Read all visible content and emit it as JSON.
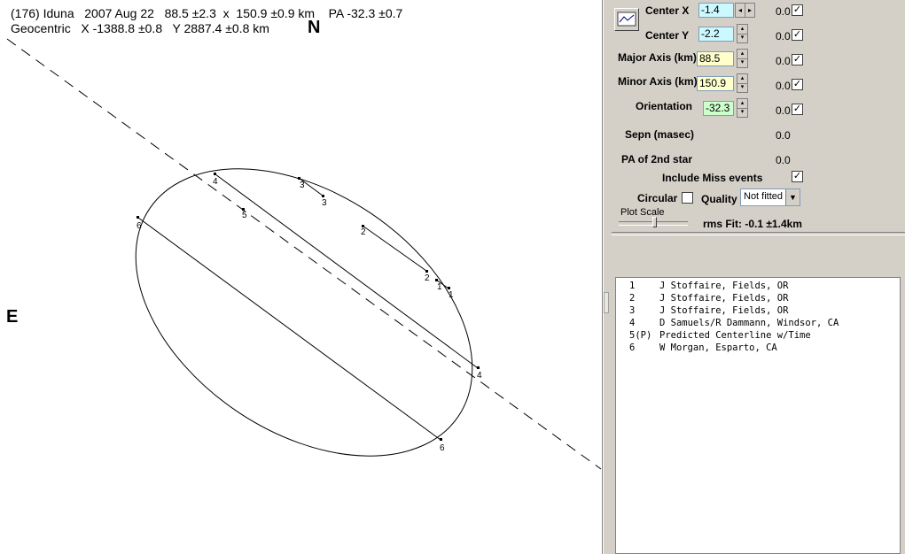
{
  "header": {
    "line1": "(176) Iduna   2007 Aug 22   88.5 ±2.3  x  150.9 ±0.9 km    PA -32.3 ±0.7",
    "line2": "Geocentric   X -1388.8 ±0.8   Y 2887.4 ±0.8 km"
  },
  "compass": {
    "north": "N",
    "east": "E"
  },
  "chord_labels": [
    "1",
    "1",
    "2",
    "2",
    "3",
    "3",
    "4",
    "4",
    "5",
    "6",
    "6"
  ],
  "panel": {
    "center_x": {
      "label": "Center X",
      "value": "-1.4",
      "sigma": "0.0",
      "checked": "✓"
    },
    "center_y": {
      "label": "Center Y",
      "value": "-2.2",
      "sigma": "0.0",
      "checked": "✓"
    },
    "major_axis": {
      "label": "Major Axis (km)",
      "value": "88.5",
      "sigma": "0.0",
      "checked": "✓"
    },
    "minor_axis": {
      "label": "Minor Axis (km)",
      "value": "150.9",
      "sigma": "0.0",
      "checked": "✓"
    },
    "orientation": {
      "label": "Orientation",
      "value": "-32.3",
      "sigma": "0.0",
      "checked": "✓"
    },
    "sepn": {
      "label": "Sepn (masec)",
      "value": "0.0"
    },
    "pa2": {
      "label": "PA of 2nd star",
      "value": "0.0"
    },
    "include_miss": {
      "label": "Include Miss events",
      "checked": "✓"
    },
    "circular": {
      "label": "Circular"
    },
    "quality": {
      "label": "Quality",
      "value": "Not fitted"
    },
    "plot_scale": {
      "label": "Plot Scale"
    },
    "rms": "rms Fit: -0.1 ±1.4km"
  },
  "observers": [
    {
      "id": "1",
      "name": "J Stoffaire, Fields, OR"
    },
    {
      "id": "2",
      "name": "J Stoffaire, Fields, OR"
    },
    {
      "id": "3",
      "name": "J Stoffaire, Fields, OR"
    },
    {
      "id": "4",
      "name": "D Samuels/R Dammann, Windsor, CA"
    },
    {
      "id": "5(P)",
      "name": "Predicted Centerline w/Time"
    },
    {
      "id": "6",
      "name": "W Morgan, Esparto, CA"
    }
  ]
}
